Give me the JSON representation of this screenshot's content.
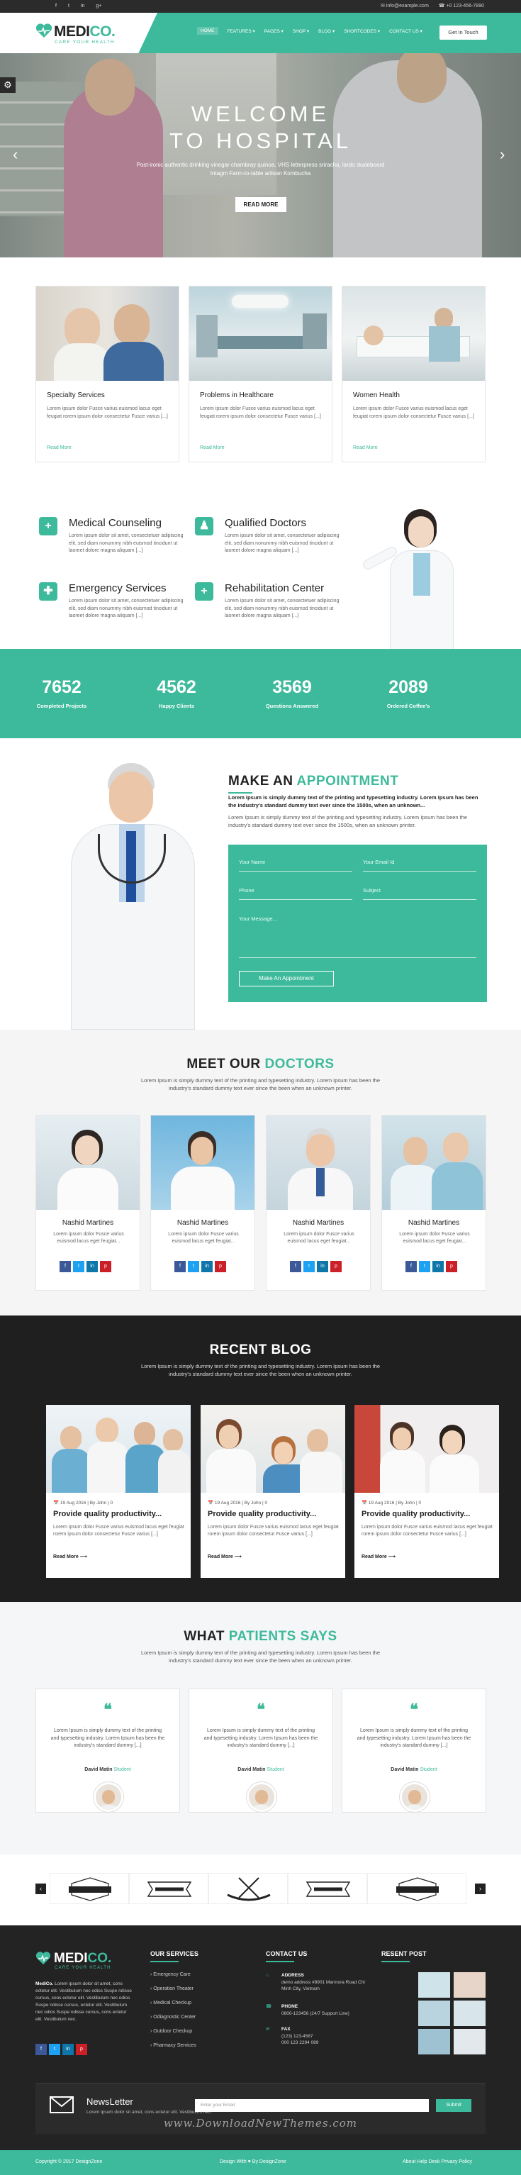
{
  "topbar": {
    "social": [
      "f",
      "t",
      "in",
      "g+"
    ],
    "email": "info@example.com",
    "phone": "+0 123-456-7890"
  },
  "header": {
    "logo_name_a": "MEDI",
    "logo_name_b": "CO.",
    "logo_tagline": "CARE YOUR HEALTH",
    "nav": [
      "HOME",
      "FEATURES ▾",
      "PAGES ▾",
      "SHOP ▾",
      "BLOG ▾",
      "SHORTCODES ▾",
      "CONTACT US ▾"
    ],
    "cta": "Get In Touch"
  },
  "hero": {
    "title_line1": "WELCOME",
    "title_line2": "TO HOSPITAL",
    "text": "Post-ironic authentic drinking vinegar chambray quinoa. VHS letterpress sriracha, lardo skateboard Intagm Farm-to-table artisan Kombucha",
    "button": "READ MORE",
    "prev": "‹",
    "next": "›",
    "settings_icon": "⚙"
  },
  "services": [
    {
      "title": "Specialty Services",
      "text": "Lorem ipsum dolor Fusce varius euismod lacus eget feugiat rorem ipsum dolor consectetur Fusce varius [...]",
      "link": "Read More"
    },
    {
      "title": "Problems in Healthcare",
      "text": "Lorem ipsum dolor Fusce varius euismod lacus eget feugiat rorem ipsum dolor consectetur Fusce varius [...]",
      "link": "Read More"
    },
    {
      "title": "Women Health",
      "text": "Lorem ipsum dolor Fusce varius euismod lacus eget feugiat rorem ipsum dolor consectetur Fusce varius [...]",
      "link": "Read More"
    }
  ],
  "features": [
    {
      "title": "Medical Counseling",
      "icon": "+",
      "text": "Lorem ipsum dolor sit amet, consectetuer adipiscing elit, sed diam nonummy nibh euismod tincidunt ut laoreet dolore magna aliquam [...]"
    },
    {
      "title": "Qualified Doctors",
      "icon": "♟",
      "text": "Lorem ipsum dolor sit amet, consectetuer adipiscing elit, sed diam nonummy nibh euismod tincidunt ut laoreet dolore magna aliquam [...]"
    },
    {
      "title": "Emergency Services",
      "icon": "✚",
      "text": "Lorem ipsum dolor sit amet, consectetuer adipiscing elit, sed diam nonummy nibh euismod tincidunt ut laoreet dolore magna aliquam [...]"
    },
    {
      "title": "Rehabilitation Center",
      "icon": "+",
      "text": "Lorem ipsum dolor sit amet, consectetuer adipiscing elit, sed diam nonummy nibh euismod tincidunt ut laoreet dolore magna aliquam [...]"
    }
  ],
  "counters": [
    {
      "value": "7652",
      "label": "Completed Projects"
    },
    {
      "value": "4562",
      "label": "Happy Clients"
    },
    {
      "value": "3569",
      "label": "Questions Answered"
    },
    {
      "value": "2089",
      "label": "Ordered Coffee's"
    }
  ],
  "appointment": {
    "title_a": "MAKE AN ",
    "title_b": "APPOINTMENT",
    "intro_bold": "Lorem Ipsum is simply dummy text of the printing and typesetting industry. Lorem Ipsum has been the industry's standard dummy text ever since the 1500s, when an unknown...",
    "intro": "Lorem Ipsum is simply dummy text of the printing and typesetting industry. Lorem Ipsum has been the industry's standard dummy text ever since the 1500s, when an unknown printer.",
    "name_ph": "Your Name",
    "email_ph": "Your Email Id",
    "phone_ph": "Phone",
    "subject_ph": "Subject",
    "message_ph": "Your Message...",
    "submit": "Make An Appointment"
  },
  "doctors": {
    "title_a": "MEET OUR ",
    "title_b": "DOCTORS",
    "intro": "Lorem Ipsum is simply dummy text of the printing and typesetting industry. Lorem Ipsum has been the industry's standard dummy text ever since the been when an unknown printer.",
    "items": [
      {
        "name": "Nashid Martines",
        "text": "Lorem ipsum dolor Fusce varius euismod lacus eget feugiat..."
      },
      {
        "name": "Nashid Martines",
        "text": "Lorem ipsum dolor Fusce varius euismod lacus eget feugiat..."
      },
      {
        "name": "Nashid Martines",
        "text": "Lorem ipsum dolor Fusce varius euismod lacus eget feugiat..."
      },
      {
        "name": "Nashid Martines",
        "text": "Lorem ipsum dolor Fusce varius euismod lacus eget feugiat..."
      }
    ],
    "social": [
      "f",
      "t",
      "in",
      "p"
    ],
    "social_colors": [
      "#3b5998",
      "#1da1f2",
      "#0e76a8",
      "#cb2027"
    ]
  },
  "blog": {
    "title": "RECENT BLOG",
    "intro": "Lorem Ipsum is simply dummy text of the printing and typesetting industry. Lorem Ipsum has been the industry's standard dummy text ever since the been when an unknown printer.",
    "posts": [
      {
        "meta": "19 Aug 2016  |  By John  |  0",
        "title": "Provide quality productivity...",
        "text": "Lorem ipsum dolor Fusce varius euismod lacus eget feugiat rorem ipsum dolor consectetur Fusce varius [...]",
        "link": "Read More ⟶"
      },
      {
        "meta": "19 Aug 2016  |  By John  |  0",
        "title": "Provide quality productivity...",
        "text": "Lorem ipsum dolor Fusce varius euismod lacus eget feugiat rorem ipsum dolor consectetur Fusce varius [...]",
        "link": "Read More ⟶"
      },
      {
        "meta": "19 Aug 2016  |  By John  |  0",
        "title": "Provide quality productivity...",
        "text": "Lorem ipsum dolor Fusce varius euismod lacus eget feugiat rorem ipsum dolor consectetur Fusce varius [...]",
        "link": "Read More ⟶"
      }
    ]
  },
  "testimonials": {
    "title_a": "WHAT ",
    "title_b": "PATIENTS SAYS",
    "intro": "Lorem Ipsum is simply dummy text of the printing and typesetting industry. Lorem Ipsum has been the industry's standard dummy text ever since the been when an unknown printer.",
    "items": [
      {
        "text": "Lorem Ipsum is simply dummy text of the printing and typesetting industry. Lorem Ipsum has been the industry's standard dummy [...]",
        "name": "David Matin",
        "role": "Student"
      },
      {
        "text": "Lorem Ipsum is simply dummy text of the printing and typesetting industry. Lorem Ipsum has been the industry's standard dummy [...]",
        "name": "David Matin",
        "role": "Student"
      },
      {
        "text": "Lorem Ipsum is simply dummy text of the printing and typesetting industry. Lorem Ipsum has been the industry's standard dummy [...]",
        "name": "David Matin",
        "role": "Student"
      }
    ],
    "quote_icon": "❝"
  },
  "clients": {
    "prev": "‹",
    "next": "›",
    "logos": [
      "RETROLOGO",
      "RETRO",
      "RETROLOGO",
      "RETRO",
      "RETROLOGO"
    ]
  },
  "footer": {
    "logo_a": "MEDI",
    "logo_b": "CO.",
    "tagline": "CARE YOUR HEALTH",
    "about_brand": "MediCo.",
    "about": " Lorem ipsum dolor sit amet, cons ectetur elit. Vestibulum nec odios Suspe ndisse cursus, cons ectetur elit. Vestibulum nec odios Suspe ndisse cursus, ectetur elit. Vestibulum nec odios Suspe ndisse cursus, cons ectetur elit. Vestibulum nec.",
    "social": [
      "f",
      "t",
      "in",
      "p"
    ],
    "services_title": "OUR SERVICES",
    "services": [
      "Emergency Care",
      "Operation Theater",
      "Medical Checkup",
      "Odiagnostic Center",
      "Outdoor Checkup",
      "Pharmacy Services"
    ],
    "contact_title": "CONTACT US",
    "address_label": "ADDRESS",
    "address": "demo address #8901 Marmora Road Chi Minh City, Vietnam",
    "phone_label": "PHONE",
    "phone": "0800-123456 (24/7 Support Line)",
    "fax_label": "FAX",
    "fax": "(123) 123-4567\n000 123 2294 089",
    "post_title": "RESENT POST",
    "news_title": "NewsLetter",
    "news_text": "Lorem ipsum dolor sit amet, cons ectetur elit. Vestibulum nec.",
    "news_placeholder": "Enter your Email",
    "news_button": "Submit",
    "watermark": "www.DownloadNewThemes.com",
    "copyright": "Copyright © 2017 DesignZone",
    "made": "Design With ♥ By DesignZone",
    "links": "About  Help Desk  Privacy Policy"
  },
  "colors": {
    "accent": "#3dba9b",
    "dark": "#232323",
    "blog_bg": "#1f1f1f"
  }
}
